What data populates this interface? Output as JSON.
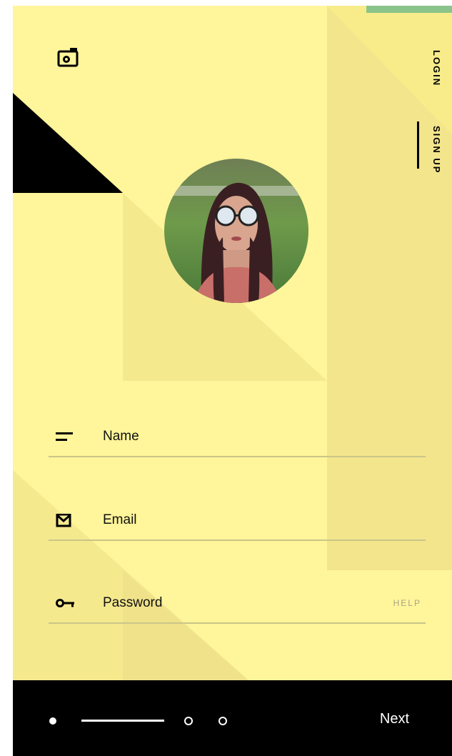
{
  "nav": {
    "login_label": "LOGIN",
    "signup_label": "SIGN UP"
  },
  "icons": {
    "camera": "camera-icon",
    "name": "text-lines-icon",
    "email": "envelope-icon",
    "password": "key-icon"
  },
  "form": {
    "name_label": "Name",
    "email_label": "Email",
    "password_label": "Password",
    "help_label": "HELP"
  },
  "footer": {
    "next_label": "Next",
    "steps_total": 3,
    "current_step": 1
  },
  "colors": {
    "background": "#fff59a",
    "accent_dark": "#000000",
    "footer": "#000000",
    "divider": "#c9c58a",
    "help_text": "#a9a48a"
  }
}
